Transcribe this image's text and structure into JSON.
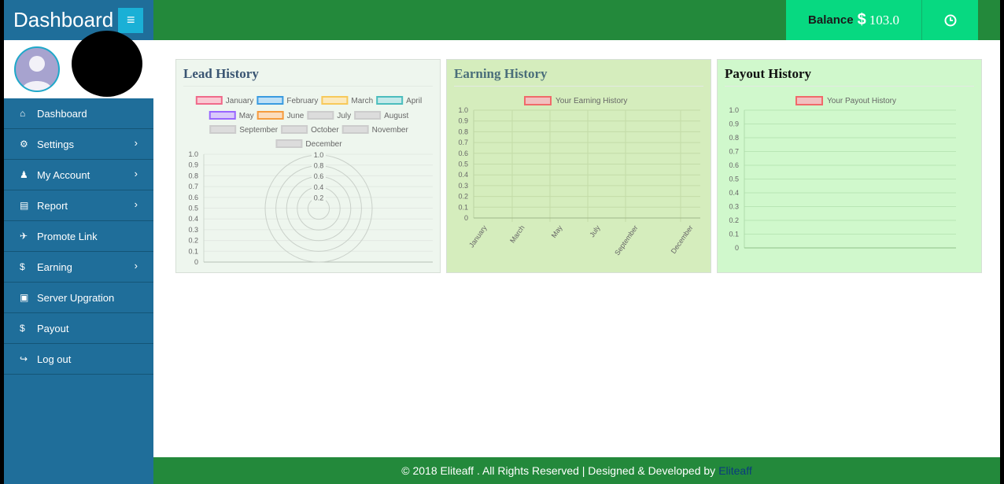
{
  "sidebar": {
    "brand": "Dashboard",
    "toggle_icon": "bars-icon",
    "items": [
      {
        "label": "Dashboard",
        "icon": "home-icon",
        "glyph": "⌂",
        "chevron": false
      },
      {
        "label": "Settings",
        "icon": "gear-icon",
        "glyph": "⚙",
        "chevron": true
      },
      {
        "label": "My Account",
        "icon": "user-icon",
        "glyph": "♟",
        "chevron": true
      },
      {
        "label": "Report",
        "icon": "file-icon",
        "glyph": "▤",
        "chevron": true
      },
      {
        "label": "Promote Link",
        "icon": "plane-icon",
        "glyph": "✈",
        "chevron": false
      },
      {
        "label": "Earning",
        "icon": "dollar-icon",
        "glyph": "$",
        "chevron": true
      },
      {
        "label": "Server Upgration",
        "icon": "gift-icon",
        "glyph": "▣",
        "chevron": false
      },
      {
        "label": "Payout",
        "icon": "dollar-icon",
        "glyph": "$",
        "chevron": false
      },
      {
        "label": "Log out",
        "icon": "sign-out-icon",
        "glyph": "↪",
        "chevron": false
      }
    ]
  },
  "topbar": {
    "balance_label": "Balance",
    "currency_symbol": "$",
    "balance_value": "103.0",
    "clock_icon": "clock-icon"
  },
  "panels": {
    "lead": {
      "title": "Lead History",
      "title_color": "#3a5572",
      "bg": "#eef6ee"
    },
    "earning": {
      "title": "Earning History",
      "title_color": "#4a6e7a",
      "bg": "#d5edbd"
    },
    "payout": {
      "title": "Payout History",
      "title_color": "#111111",
      "bg": "#d0f8cc"
    }
  },
  "chart_data": [
    {
      "type": "polar-area",
      "title": "Lead History",
      "legend": [
        {
          "label": "January",
          "color": "#f06a8a",
          "fill": "#f9c9d3"
        },
        {
          "label": "February",
          "color": "#3a9be0",
          "fill": "#bfe0f6"
        },
        {
          "label": "March",
          "color": "#f7c95a",
          "fill": "#fbe9bd"
        },
        {
          "label": "April",
          "color": "#4bbdbd",
          "fill": "#c4e9e9"
        },
        {
          "label": "May",
          "color": "#9966ff",
          "fill": "#d9c9fa"
        },
        {
          "label": "June",
          "color": "#f59b3e",
          "fill": "#fbdcbd"
        },
        {
          "label": "July",
          "color": "#cccccc",
          "fill": "#dcdcdc"
        },
        {
          "label": "August",
          "color": "#cccccc",
          "fill": "#dcdcdc"
        },
        {
          "label": "September",
          "color": "#cccccc",
          "fill": "#dcdcdc"
        },
        {
          "label": "October",
          "color": "#cccccc",
          "fill": "#dcdcdc"
        },
        {
          "label": "November",
          "color": "#cccccc",
          "fill": "#dcdcdc"
        },
        {
          "label": "December",
          "color": "#cccccc",
          "fill": "#dcdcdc"
        }
      ],
      "y_ticks": [
        "1.0",
        "0.9",
        "0.8",
        "0.7",
        "0.6",
        "0.5",
        "0.4",
        "0.3",
        "0.2",
        "0.1",
        "0"
      ],
      "radial_ticks": [
        "1.0",
        "0.8",
        "0.6",
        "0.4",
        "0.2"
      ],
      "values": [],
      "ylim": [
        0,
        1
      ]
    },
    {
      "type": "line",
      "title": "Earning History",
      "series": [
        {
          "name": "Your Earning History",
          "color": "#f06a6a",
          "values": []
        }
      ],
      "categories": [
        "January",
        "March",
        "May",
        "July",
        "September",
        "December"
      ],
      "y_ticks": [
        "1.0",
        "0.9",
        "0.8",
        "0.7",
        "0.6",
        "0.5",
        "0.4",
        "0.3",
        "0.2",
        "0.1",
        "0"
      ],
      "ylim": [
        0,
        1
      ]
    },
    {
      "type": "line",
      "title": "Payout History",
      "series": [
        {
          "name": "Your Payout History",
          "color": "#f06a6a",
          "values": []
        }
      ],
      "categories": [],
      "y_ticks": [
        "1.0",
        "0.9",
        "0.8",
        "0.7",
        "0.6",
        "0.5",
        "0.4",
        "0.3",
        "0.2",
        "0.1",
        "0"
      ],
      "ylim": [
        0,
        1
      ]
    }
  ],
  "footer": {
    "text": "© 2018 Eliteaff . All Rights Reserved | Designed & Developed by",
    "link": "Eliteaff"
  }
}
